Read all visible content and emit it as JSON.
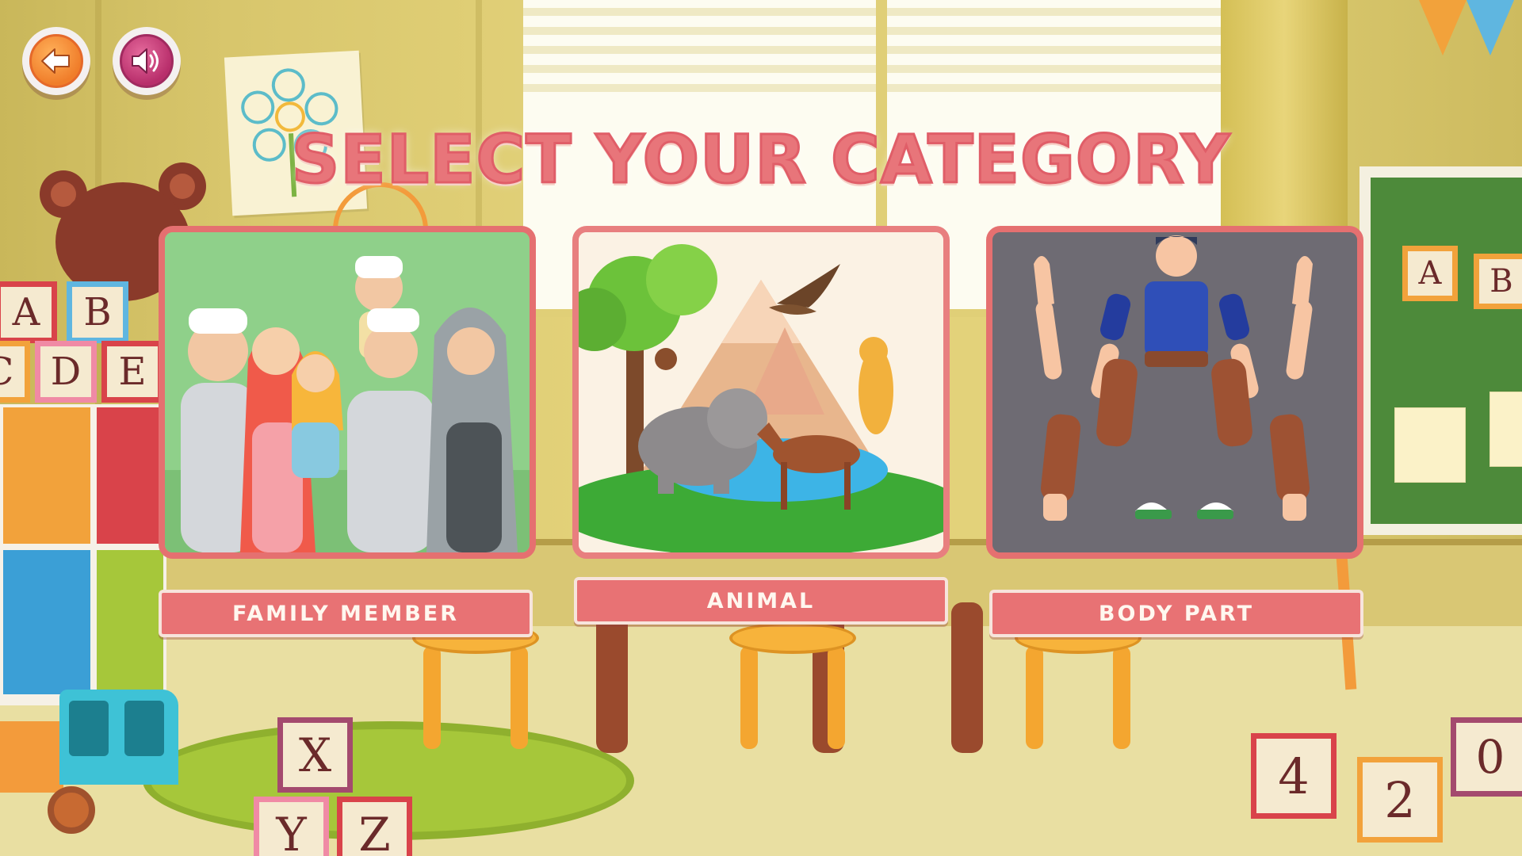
{
  "header": {
    "title": "SELECT YOUR CATEGORY"
  },
  "controls": {
    "back_icon": "arrow-left-icon",
    "sound_icon": "speaker-icon"
  },
  "categories": [
    {
      "label": "FAMILY MEMBER",
      "image": "family-illustration"
    },
    {
      "label": "ANIMAL",
      "image": "wildlife-illustration"
    },
    {
      "label": "BODY PART",
      "image": "body-parts-illustration"
    }
  ],
  "decor": {
    "blocks_left": [
      "A",
      "B",
      "C",
      "D",
      "E"
    ],
    "blocks_bottom_left": [
      "X",
      "Y",
      "Z"
    ],
    "blocks_bottom_right": [
      "4",
      "2",
      "0"
    ],
    "board_letters": [
      "A",
      "B"
    ]
  },
  "colors": {
    "title": "#e8757a",
    "card_border": "#e57070",
    "label_bg": "#e87274",
    "back_button": "#f07d2a",
    "sound_button": "#b82e6b"
  }
}
